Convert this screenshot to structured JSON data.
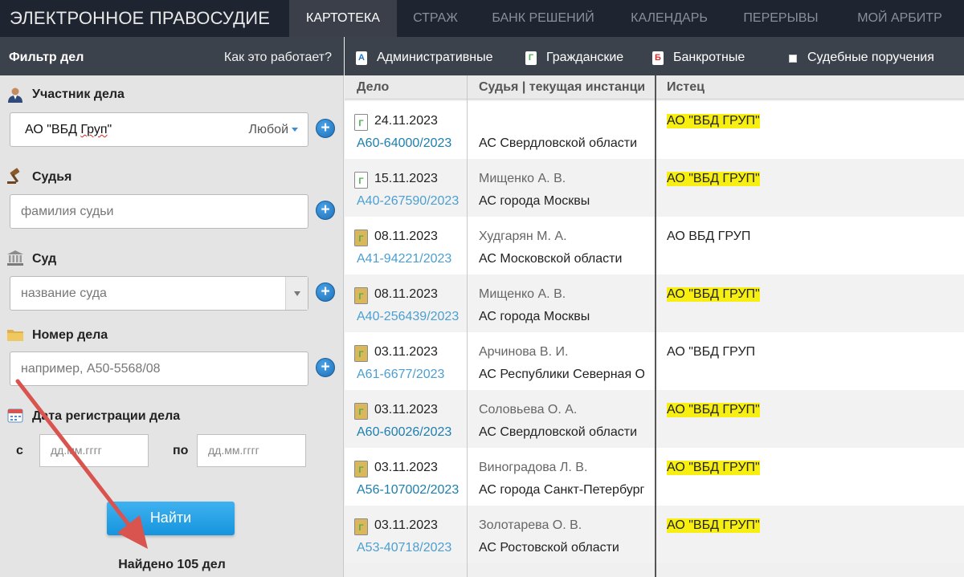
{
  "app": {
    "brand": "ЭЛЕКТРОННОЕ ПРАВОСУДИЕ",
    "nav_tabs": [
      {
        "label": "КАРТОТЕКА",
        "active": true
      },
      {
        "label": "СТРАЖ",
        "active": false
      },
      {
        "label": "БАНК РЕШЕНИЙ",
        "active": false
      },
      {
        "label": "КАЛЕНДАРЬ",
        "active": false
      },
      {
        "label": "ПЕРЕРЫВЫ",
        "active": false
      },
      {
        "label": "МОЙ АРБИТР",
        "active": false
      }
    ]
  },
  "filter": {
    "title": "Фильтр дел",
    "how_link": "Как это работает?",
    "participant": {
      "label": "Участник дела",
      "value_prefix": "АО \"ВБД ",
      "value_word": "Груп",
      "value_suffix": "\"",
      "role": "Любой",
      "icon": "person-icon"
    },
    "judge": {
      "label": "Судья",
      "placeholder": "фамилия судьи",
      "icon": "gavel-icon"
    },
    "court": {
      "label": "Суд",
      "placeholder": "название суда",
      "icon": "courthouse-icon"
    },
    "case_number": {
      "label": "Номер дела",
      "placeholder": "например, А50-5568/08",
      "icon": "folder-icon"
    },
    "reg_date": {
      "label": "Дата регистрации дела",
      "from_label": "с",
      "to_label": "по",
      "from_placeholder": "дд.мм.гггг",
      "to_placeholder": "дд.мм.гггг",
      "icon": "calendar-icon"
    },
    "find_button": "Найти",
    "found_text": "Найдено 105 дел",
    "annotation_arrow_color": "#d9534f"
  },
  "case_types": [
    {
      "badge": "А",
      "label": "Административные",
      "badge_color": "#1f78c8"
    },
    {
      "badge": "Г",
      "label": "Гражданские",
      "badge_color": "#4caf50"
    },
    {
      "badge": "Б",
      "label": "Банкротные",
      "badge_color": "#d32f2f"
    },
    {
      "badge": "",
      "label": "Судебные поручения",
      "badge_color": "#ffffff"
    }
  ],
  "table": {
    "headers": {
      "case": "Дело",
      "judge": "Судья | текущая инстанция",
      "plaintiff": "Истец"
    },
    "rows": [
      {
        "date": "24.11.2023",
        "case": "А60-64000/2023",
        "judge": "",
        "court": "АС Свердловской области",
        "plaintiff": "АО \"ВБД ГРУП\"",
        "highlight": true,
        "icon": "document-white-icon",
        "link_style": "dark"
      },
      {
        "date": "15.11.2023",
        "case": "А40-267590/2023",
        "judge": "Мищенко А. В.",
        "court": "АС города Москвы",
        "plaintiff": "АО \"ВБД ГРУП\"",
        "highlight": true,
        "icon": "document-white-icon",
        "link_style": "light"
      },
      {
        "date": "08.11.2023",
        "case": "А41-94221/2023",
        "judge": "Худгарян М. А.",
        "court": "АС Московской области",
        "plaintiff": "АО ВБД ГРУП",
        "highlight": false,
        "icon": "document-gold-icon",
        "link_style": "light"
      },
      {
        "date": "08.11.2023",
        "case": "А40-256439/2023",
        "judge": "Мищенко А. В.",
        "court": "АС города Москвы",
        "plaintiff": "АО \"ВБД ГРУП\"",
        "highlight": true,
        "icon": "document-gold-icon",
        "link_style": "light"
      },
      {
        "date": "03.11.2023",
        "case": "А61-6677/2023",
        "judge": "Арчинова В. И.",
        "court": "АС Республики Северная Осетия",
        "plaintiff": "АО \"ВБД ГРУП",
        "highlight": false,
        "icon": "document-gold-icon",
        "link_style": "light"
      },
      {
        "date": "03.11.2023",
        "case": "А60-60026/2023",
        "judge": "Соловьева О. А.",
        "court": "АС Свердловской области",
        "plaintiff": "АО \"ВБД ГРУП\"",
        "highlight": true,
        "icon": "document-gold-icon",
        "link_style": "dark"
      },
      {
        "date": "03.11.2023",
        "case": "А56-107002/2023",
        "judge": "Виноградова Л. В.",
        "court": "АС города Санкт-Петербурга",
        "plaintiff": "АО \"ВБД ГРУП\"",
        "highlight": true,
        "icon": "document-gold-icon",
        "link_style": "dark"
      },
      {
        "date": "03.11.2023",
        "case": "А53-40718/2023",
        "judge": "Золотарева О. В.",
        "court": "АС Ростовской области",
        "plaintiff": "АО \"ВБД ГРУП\"",
        "highlight": true,
        "icon": "document-gold-icon",
        "link_style": "light"
      }
    ]
  }
}
